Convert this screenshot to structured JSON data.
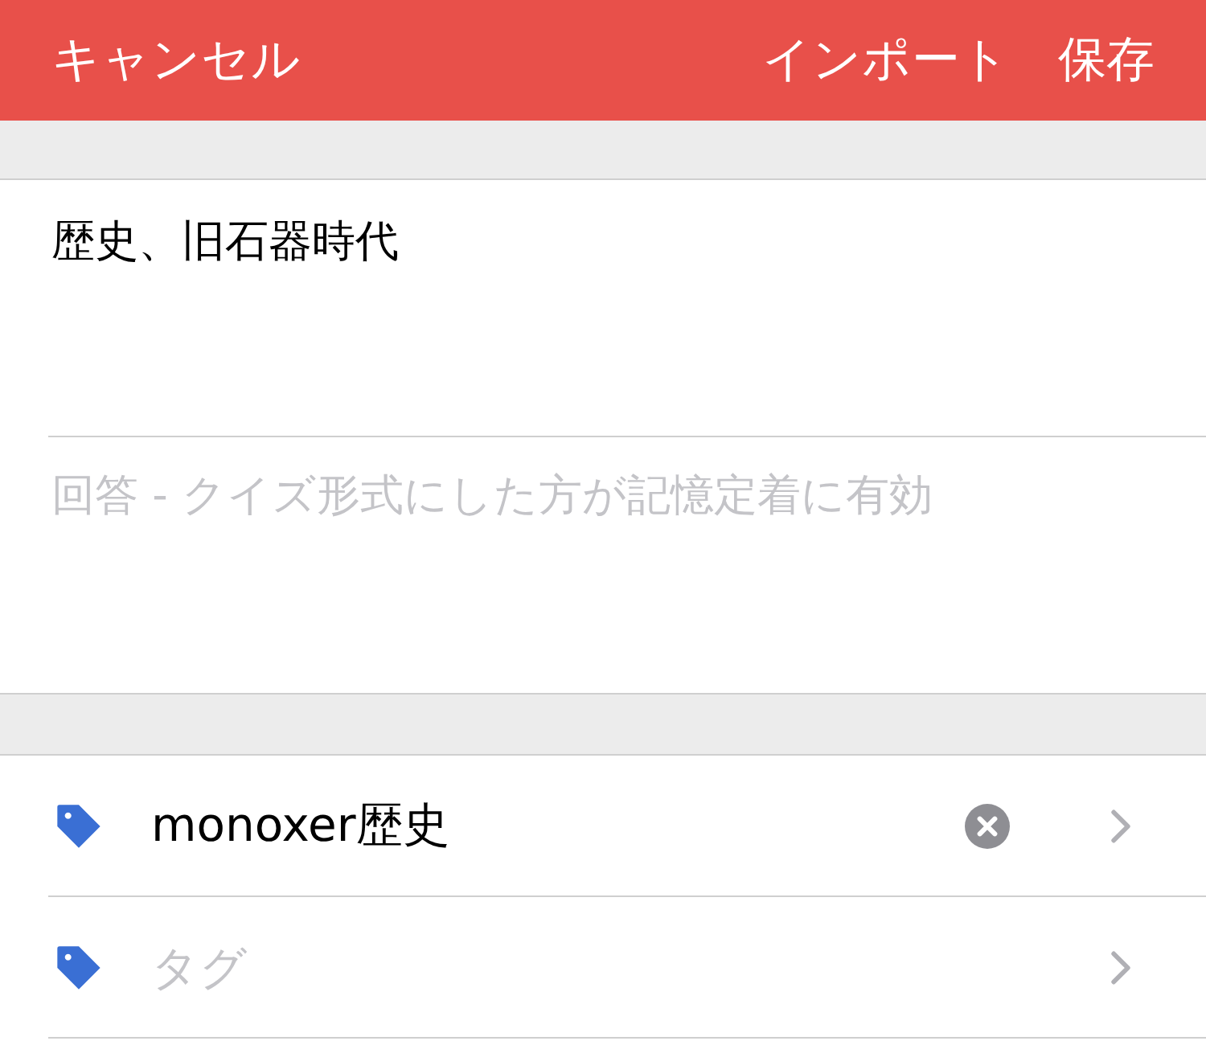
{
  "header": {
    "cancel": "キャンセル",
    "import": "インポート",
    "save": "保存"
  },
  "question": {
    "value": "歴史、旧石器時代"
  },
  "answer": {
    "placeholder": "回答 - クイズ形式にした方が記憶定着に有効"
  },
  "tags": [
    {
      "value": "monoxer歴史",
      "clearable": true
    },
    {
      "placeholder": "タグ",
      "clearable": false
    }
  ]
}
